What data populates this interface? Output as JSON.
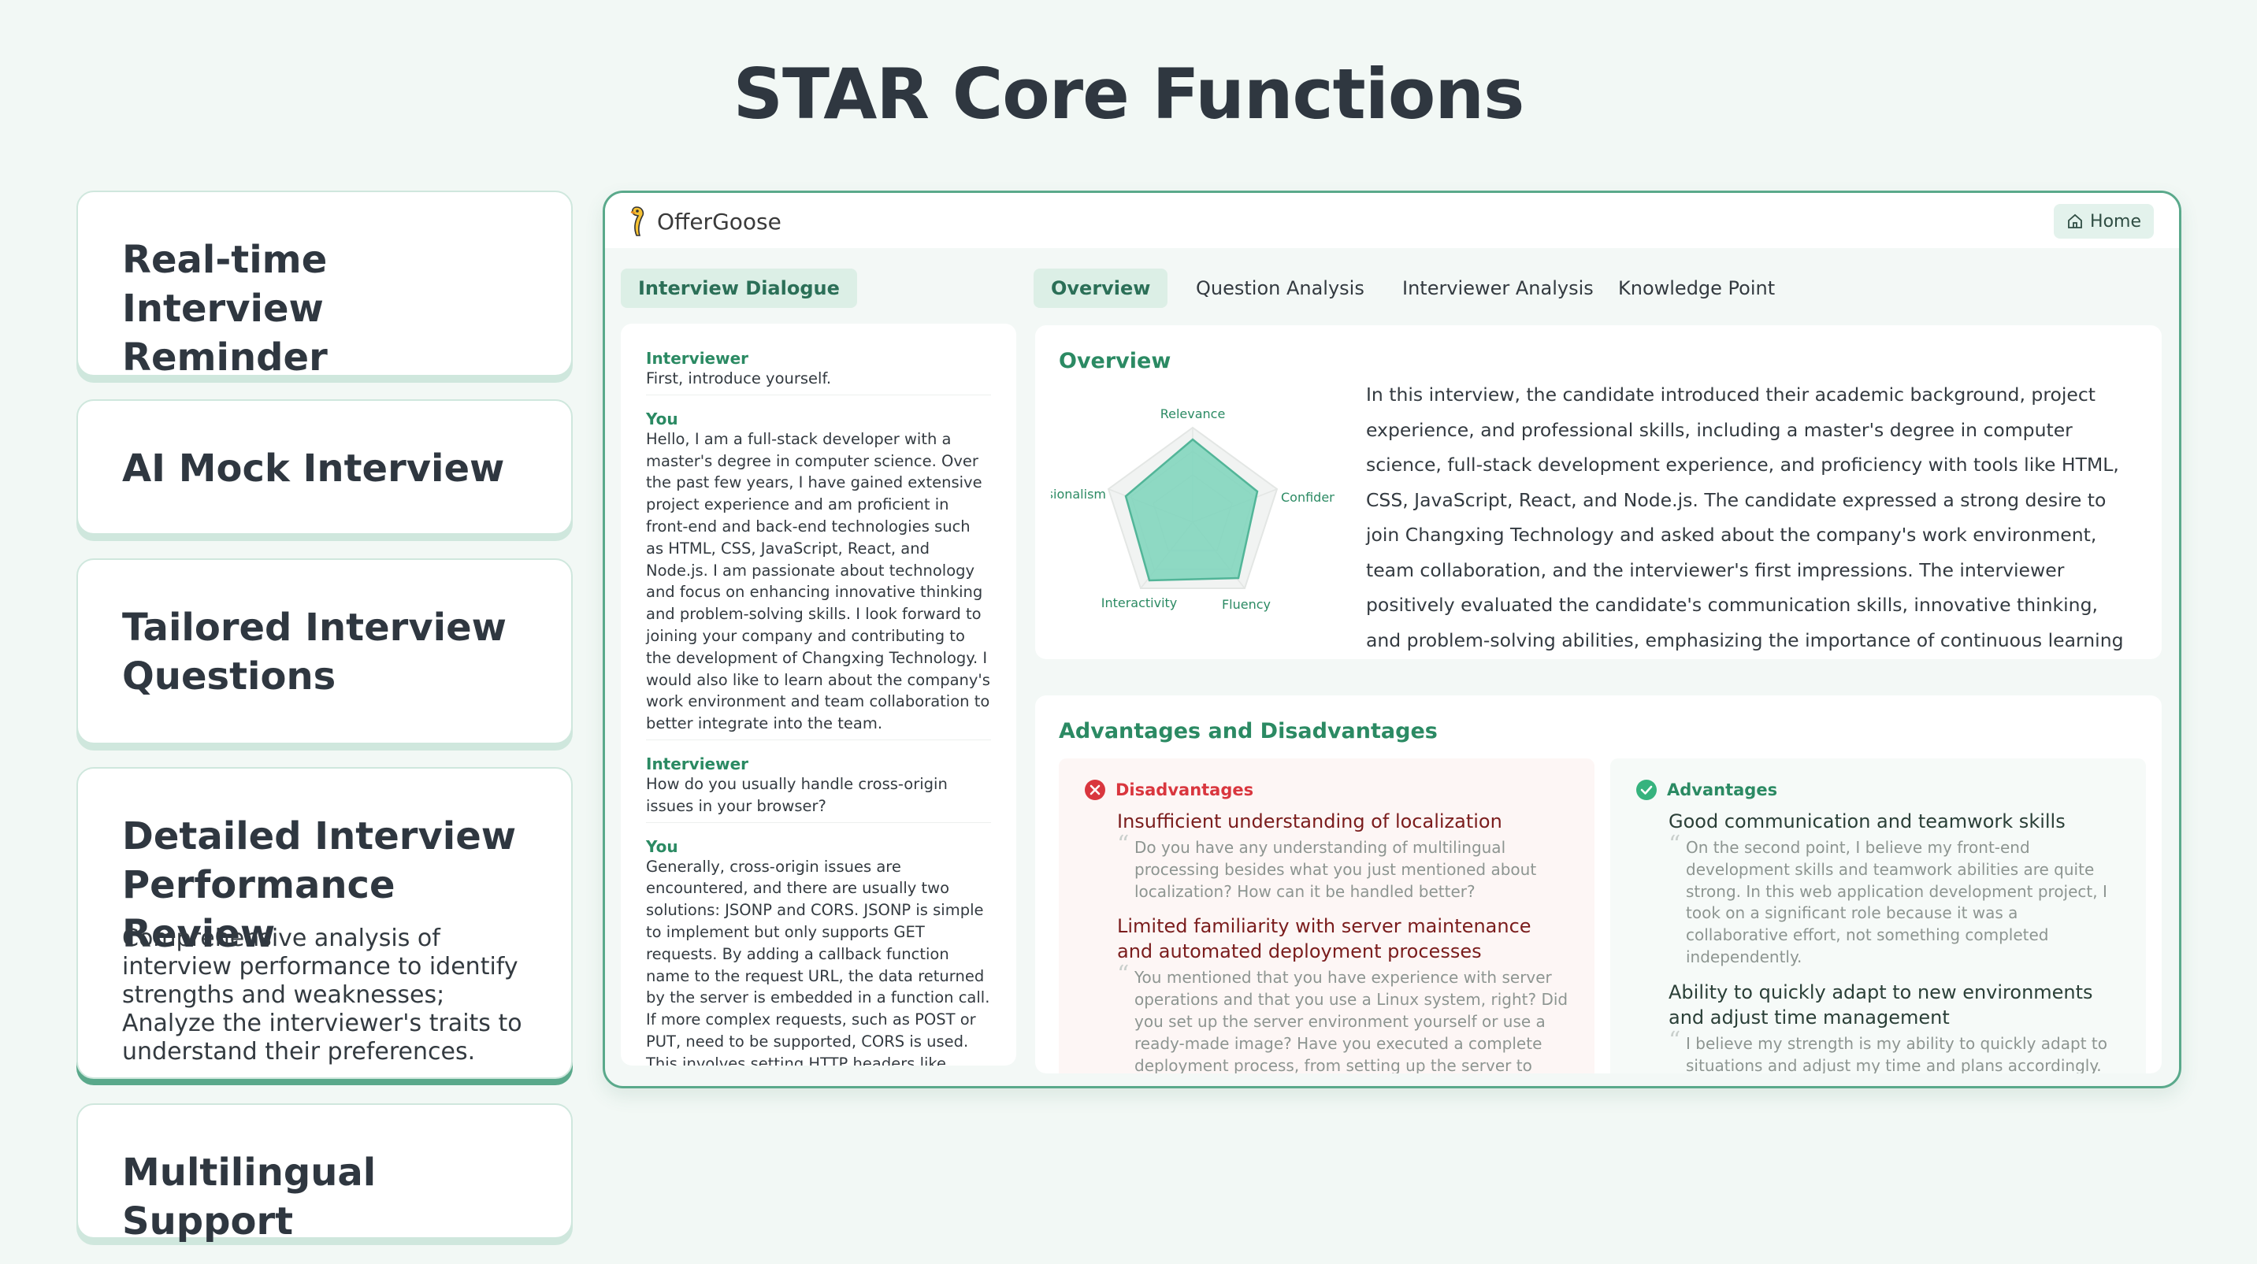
{
  "page_title": "STAR Core Functions",
  "features": [
    {
      "title": "Real-time Interview Reminder"
    },
    {
      "title": "AI Mock Interview"
    },
    {
      "title": "Tailored Interview Questions"
    },
    {
      "title": "Detailed Interview Performance Review",
      "description": "Comprehensive analysis of interview performance to identify strengths and weaknesses; Analyze the interviewer's traits to understand their preferences."
    },
    {
      "title": "Multilingual Support"
    }
  ],
  "app": {
    "logo_text": "OfferGoose",
    "home_label": "Home",
    "dialogue_tab": "Interview Dialogue",
    "tabs": [
      "Overview",
      "Question Analysis",
      "Interviewer Analysis",
      "Knowledge Point"
    ],
    "dialogue": [
      {
        "speaker": "Interviewer",
        "text": "First, introduce yourself."
      },
      {
        "speaker": "You",
        "text": "Hello, I am a full-stack developer with a master's degree in computer science. Over the past few years, I have gained extensive project experience and am proficient in front-end and back-end technologies such as HTML, CSS, JavaScript, React, and Node.js. I am passionate about technology and focus on enhancing innovative thinking and problem-solving skills. I look forward to joining your company and contributing to the development of Changxing Technology. I would also like to learn about the company's work environment and team collaboration to better integrate into the team."
      },
      {
        "speaker": "Interviewer",
        "text": "How do you usually handle cross-origin issues in your browser?"
      },
      {
        "speaker": "You",
        "text": "Generally, cross-origin issues are encountered, and there are usually two solutions: JSONP and CORS. JSONP is simple to implement but only supports GET requests. By adding a callback function name to the request URL, the data returned by the server is embedded in a function call. If more complex requests, such as POST or PUT, need to be supported, CORS is used. This involves setting HTTP headers like Access-Control-Allow-Origin on the server side to allow specific or all origins to make"
      }
    ],
    "overview": {
      "title": "Overview",
      "radar_labels": [
        "Relevance",
        "Confidence",
        "Fluency",
        "Interactivity",
        "Professionalism"
      ],
      "text": "In this interview, the candidate introduced their academic background, project experience, and professional skills, including a master's degree in computer science, full-stack development experience, and proficiency with tools like HTML, CSS, JavaScript, React, and Node.js. The candidate expressed a strong desire to join Changxing Technology and asked about the company's work environment, team collaboration, and the interviewer's first impressions. The interviewer positively evaluated the candidate's communication skills, innovative thinking, and problem-solving abilities, emphasizing the importance of continuous learning and adapting to new technologies for the position."
    },
    "adv_dis": {
      "title": "Advantages and Disadvantages",
      "disadvantages_label": "Disadvantages",
      "advantages_label": "Advantages",
      "disadvantages": [
        {
          "title": "Insufficient understanding of localization",
          "quote": "Do you have any understanding of multilingual processing besides what you just mentioned about localization? How can it be handled better?"
        },
        {
          "title": "Limited familiarity with server maintenance and automated deployment processes",
          "quote": "You mentioned that you have experience with server operations and that you use a Linux system, right? Did you set up the server environment yourself or use a ready-made image? Have you executed a complete deployment process, from setting up the server to launching the application?"
        }
      ],
      "advantages": [
        {
          "title": "Good communication and teamwork skills",
          "quote": "On the second point, I believe my front-end development skills and teamwork abilities are quite strong. In this web application development project, I took on a significant role because it was a collaborative effort, not something completed independently."
        },
        {
          "title": "Ability to quickly adapt to new environments and adjust time management",
          "quote": "I believe my strength is my ability to quickly adapt to situations and adjust my time and plans accordingly. Once I clarify the issue, I can promptly engage in the process to"
        }
      ]
    },
    "colors": {
      "accent": "#2b8a63",
      "border": "#5aa98b",
      "danger": "#d9363e"
    }
  }
}
